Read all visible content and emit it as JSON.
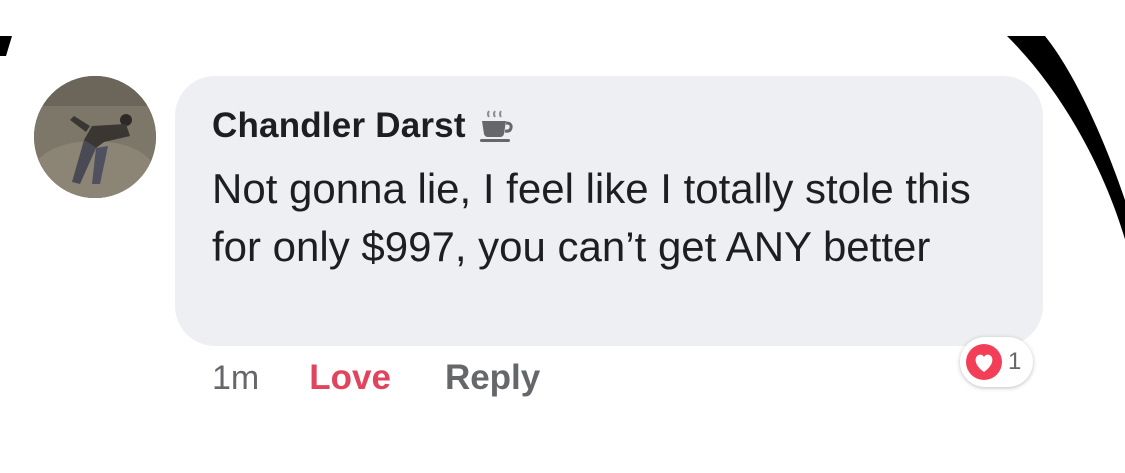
{
  "comment": {
    "author": "Chandler Darst",
    "badge_icon": "coffee-cup-icon",
    "text": "Not gonna lie, I feel like I totally stole this for only $997, you can’t get ANY better"
  },
  "actions": {
    "timestamp": "1m",
    "love_label": "Love",
    "reply_label": "Reply"
  },
  "reactions": {
    "icon": "heart-icon",
    "count": "1"
  },
  "colors": {
    "bubble": "#eeeff2",
    "love": "#e0455d",
    "muted": "#65676b",
    "heart": "#f33e58"
  }
}
